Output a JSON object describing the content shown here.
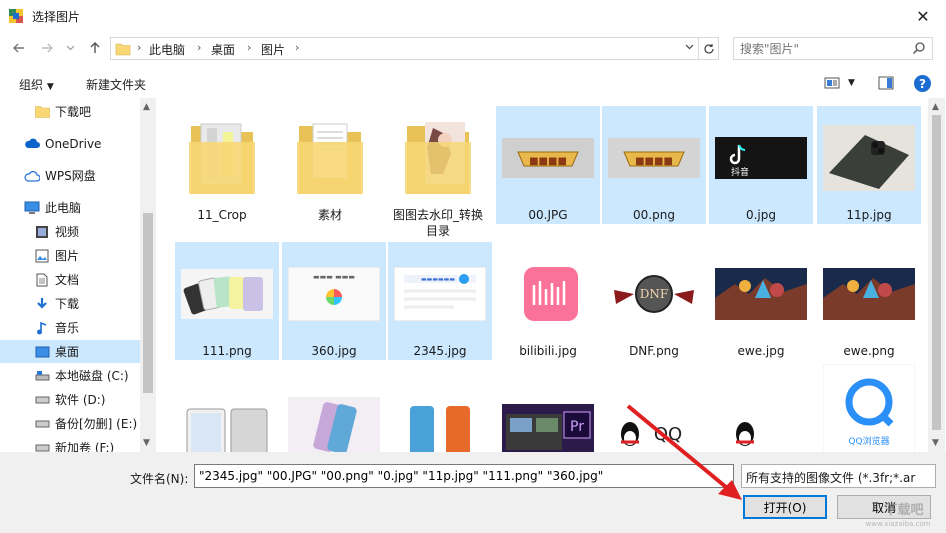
{
  "window": {
    "title": "选择图片",
    "close_label": "✕"
  },
  "address": {
    "crumbs": [
      "此电脑",
      "桌面",
      "图片"
    ]
  },
  "search": {
    "placeholder": "搜索\"图片\""
  },
  "toolbar": {
    "organize": "组织",
    "new_folder": "新建文件夹"
  },
  "sidebar": {
    "items": [
      {
        "label": "下载吧",
        "icon": "folder-icon"
      },
      {
        "label": "OneDrive",
        "icon": "cloud-icon"
      },
      {
        "label": "WPS网盘",
        "icon": "wps-cloud-icon"
      },
      {
        "label": "此电脑",
        "icon": "computer-icon"
      },
      {
        "label": "视频",
        "icon": "video-icon"
      },
      {
        "label": "图片",
        "icon": "pictures-icon"
      },
      {
        "label": "文档",
        "icon": "documents-icon"
      },
      {
        "label": "下载",
        "icon": "download-icon"
      },
      {
        "label": "音乐",
        "icon": "music-icon"
      },
      {
        "label": "桌面",
        "icon": "desktop-icon",
        "selected": true
      },
      {
        "label": "本地磁盘 (C:)",
        "icon": "drive-icon"
      },
      {
        "label": "软件 (D:)",
        "icon": "drive-icon"
      },
      {
        "label": "备份[勿删] (E:)",
        "icon": "drive-icon"
      },
      {
        "label": "新加卷 (F:)",
        "icon": "drive-icon"
      }
    ]
  },
  "files": [
    {
      "name": "11_Crop",
      "kind": "folder",
      "selected": false
    },
    {
      "name": "素材",
      "kind": "folder",
      "selected": false
    },
    {
      "name": "图图去水印_转换目录",
      "kind": "folder",
      "selected": false
    },
    {
      "name": "00.JPG",
      "kind": "image",
      "selected": true
    },
    {
      "name": "00.png",
      "kind": "image",
      "selected": true
    },
    {
      "name": "0.jpg",
      "kind": "image",
      "selected": true
    },
    {
      "name": "11p.jpg",
      "kind": "image",
      "selected": true
    },
    {
      "name": "111.png",
      "kind": "image",
      "selected": true
    },
    {
      "name": "360.jpg",
      "kind": "image",
      "selected": true
    },
    {
      "name": "2345.jpg",
      "kind": "image",
      "selected": true
    },
    {
      "name": "bilibili.jpg",
      "kind": "image",
      "selected": false
    },
    {
      "name": "DNF.png",
      "kind": "image",
      "selected": false
    },
    {
      "name": "ewe.jpg",
      "kind": "image",
      "selected": false
    },
    {
      "name": "ewe.png",
      "kind": "image",
      "selected": false
    },
    {
      "name": "",
      "kind": "image",
      "selected": false
    },
    {
      "name": "",
      "kind": "image",
      "selected": false
    },
    {
      "name": "",
      "kind": "image",
      "selected": false
    },
    {
      "name": "",
      "kind": "image",
      "selected": false
    },
    {
      "name": "",
      "kind": "image",
      "selected": false
    },
    {
      "name": "",
      "kind": "image",
      "selected": false
    },
    {
      "name": "",
      "kind": "image",
      "selected": false
    }
  ],
  "thumb_text": {
    "tiktok": "抖音",
    "qq": "QQ",
    "qq_browser": "QQ浏览器",
    "dnf": "DNF",
    "pr": "Pr"
  },
  "footer": {
    "filename_label": "文件名(N):",
    "filename_value": "\"2345.jpg\" \"00.JPG\" \"00.png\" \"0.jpg\" \"11p.jpg\" \"111.png\" \"360.jpg\"",
    "filter_label": "所有支持的图像文件 (*.3fr;*.ar",
    "open_button": "打开(O)",
    "cancel_button": "取消"
  },
  "watermark": {
    "text": "下载吧",
    "url": "www.xiazaiba.com"
  },
  "colors": {
    "selection": "#cce8ff",
    "accent": "#0078d7",
    "arrow": "#e02020"
  }
}
